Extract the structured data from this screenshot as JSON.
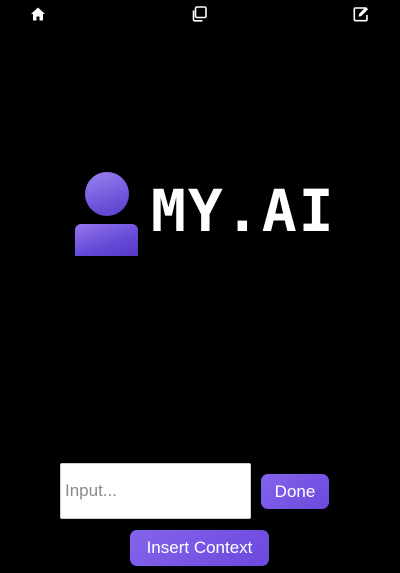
{
  "topbar": {
    "home_icon": "home-icon",
    "copy_icon": "copy-icon",
    "edit_icon": "edit-icon"
  },
  "logo": {
    "text": "MY.AI",
    "icon": "user-icon",
    "accent_color": "#6b4fd8"
  },
  "composer": {
    "input_placeholder": "Input...",
    "input_value": "",
    "done_label": "Done",
    "insert_context_label": "Insert Context"
  },
  "colors": {
    "background": "#000000",
    "button": "#7457e3",
    "text": "#ffffff"
  }
}
